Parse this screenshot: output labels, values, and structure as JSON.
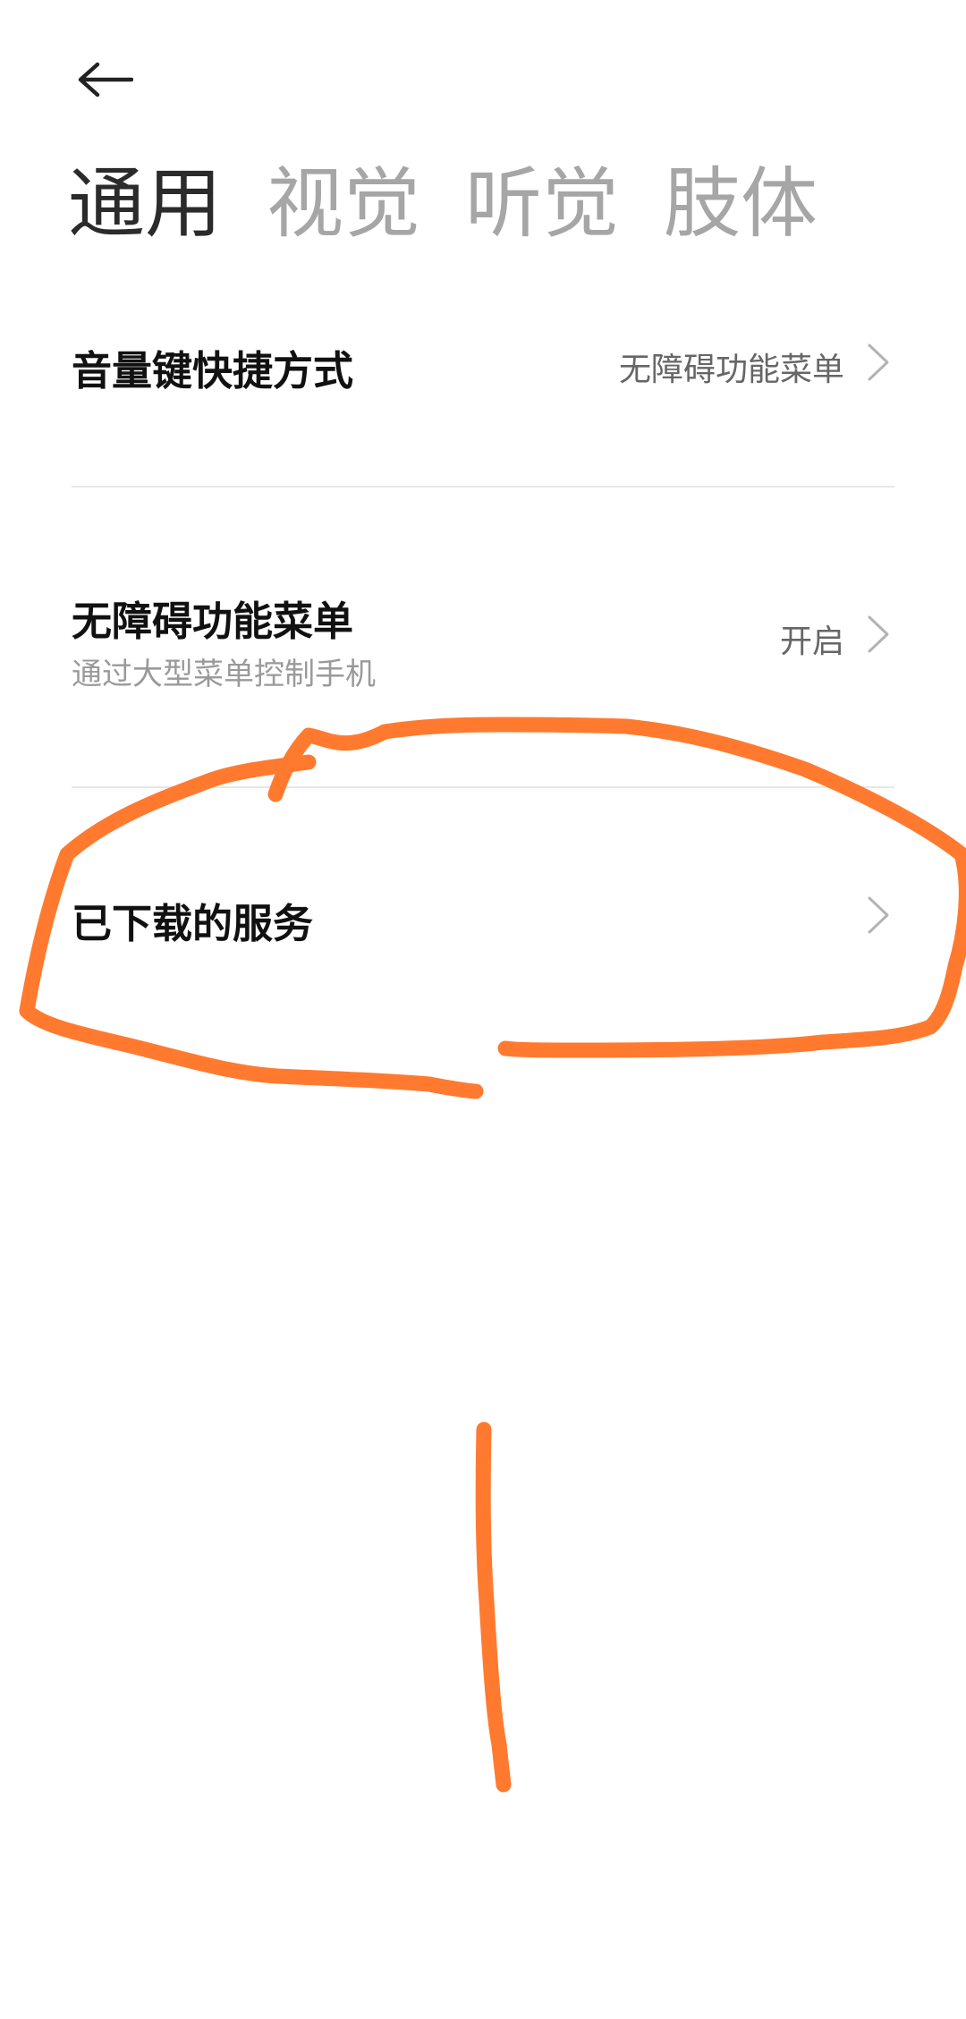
{
  "header": {
    "back_icon": "arrow-left-icon"
  },
  "tabs": [
    {
      "label": "通用",
      "active": true
    },
    {
      "label": "视觉",
      "active": false
    },
    {
      "label": "听觉",
      "active": false
    },
    {
      "label": "肢体",
      "active": false
    }
  ],
  "settings": [
    {
      "title": "音量键快捷方式",
      "value": "无障碍功能菜单"
    },
    {
      "title": "无障碍功能菜单",
      "subtitle": "通过大型菜单控制手机",
      "value": "开启"
    },
    {
      "title": "已下载的服务"
    }
  ],
  "colors": {
    "annotation_stroke": "#ff7a2f",
    "active_tab": "#2b2b2b",
    "inactive_tab": "#a6a6a6"
  }
}
